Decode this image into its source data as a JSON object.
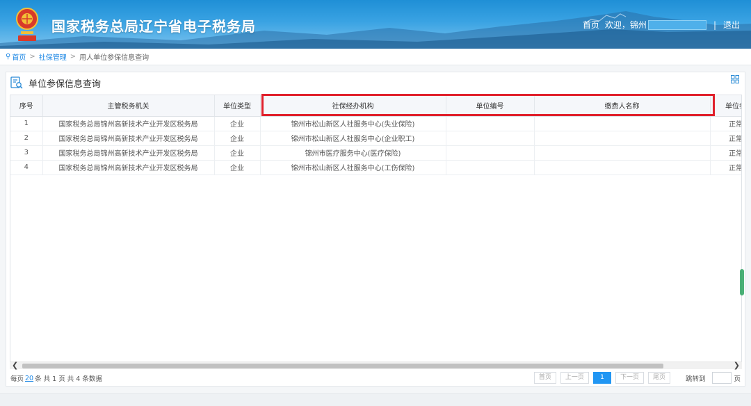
{
  "header": {
    "title": "国家税务总局辽宁省电子税务局",
    "home_link": "首页",
    "welcome": "欢迎，锦州",
    "separator": "|",
    "logout": "退出"
  },
  "breadcrumb": {
    "home": "首页",
    "section": "社保管理",
    "current": "用人单位参保信息查询",
    "sep": ">"
  },
  "panel": {
    "title": "单位参保信息查询"
  },
  "table": {
    "columns": [
      "序号",
      "主管税务机关",
      "单位类型",
      "社保经办机构",
      "单位编号",
      "缴费人名称",
      "单位参保"
    ],
    "rows": [
      {
        "no": "1",
        "tax_office": "国家税务总局锦州高新技术产业开发区税务局",
        "unit_type": "企业",
        "agency": "锦州市松山新区人社服务中心(失业保险)",
        "unit_no": "",
        "payer": "",
        "status": "正常参"
      },
      {
        "no": "2",
        "tax_office": "国家税务总局锦州高新技术产业开发区税务局",
        "unit_type": "企业",
        "agency": "锦州市松山新区人社服务中心(企业职工)",
        "unit_no": "",
        "payer": "",
        "status": "正常参"
      },
      {
        "no": "3",
        "tax_office": "国家税务总局锦州高新技术产业开发区税务局",
        "unit_type": "企业",
        "agency": "锦州市医疗服务中心(医疗保险)",
        "unit_no": "",
        "payer": "",
        "status": "正常参"
      },
      {
        "no": "4",
        "tax_office": "国家税务总局锦州高新技术产业开发区税务局",
        "unit_type": "企业",
        "agency": "锦州市松山新区人社服务中心(工伤保险)",
        "unit_no": "",
        "payer": "",
        "status": "正常参"
      }
    ]
  },
  "pager": {
    "per_page_prefix": "每页",
    "per_page_size": "20",
    "summary": "条 共 1 页  共 4 条数据",
    "first": "首页",
    "prev": "上一页",
    "current": "1",
    "next": "下一页",
    "last": "尾页",
    "jump_to": "跳转到",
    "page_suffix": "页"
  },
  "colors": {
    "accent": "#2196f3",
    "highlight_border": "#e0202b"
  }
}
